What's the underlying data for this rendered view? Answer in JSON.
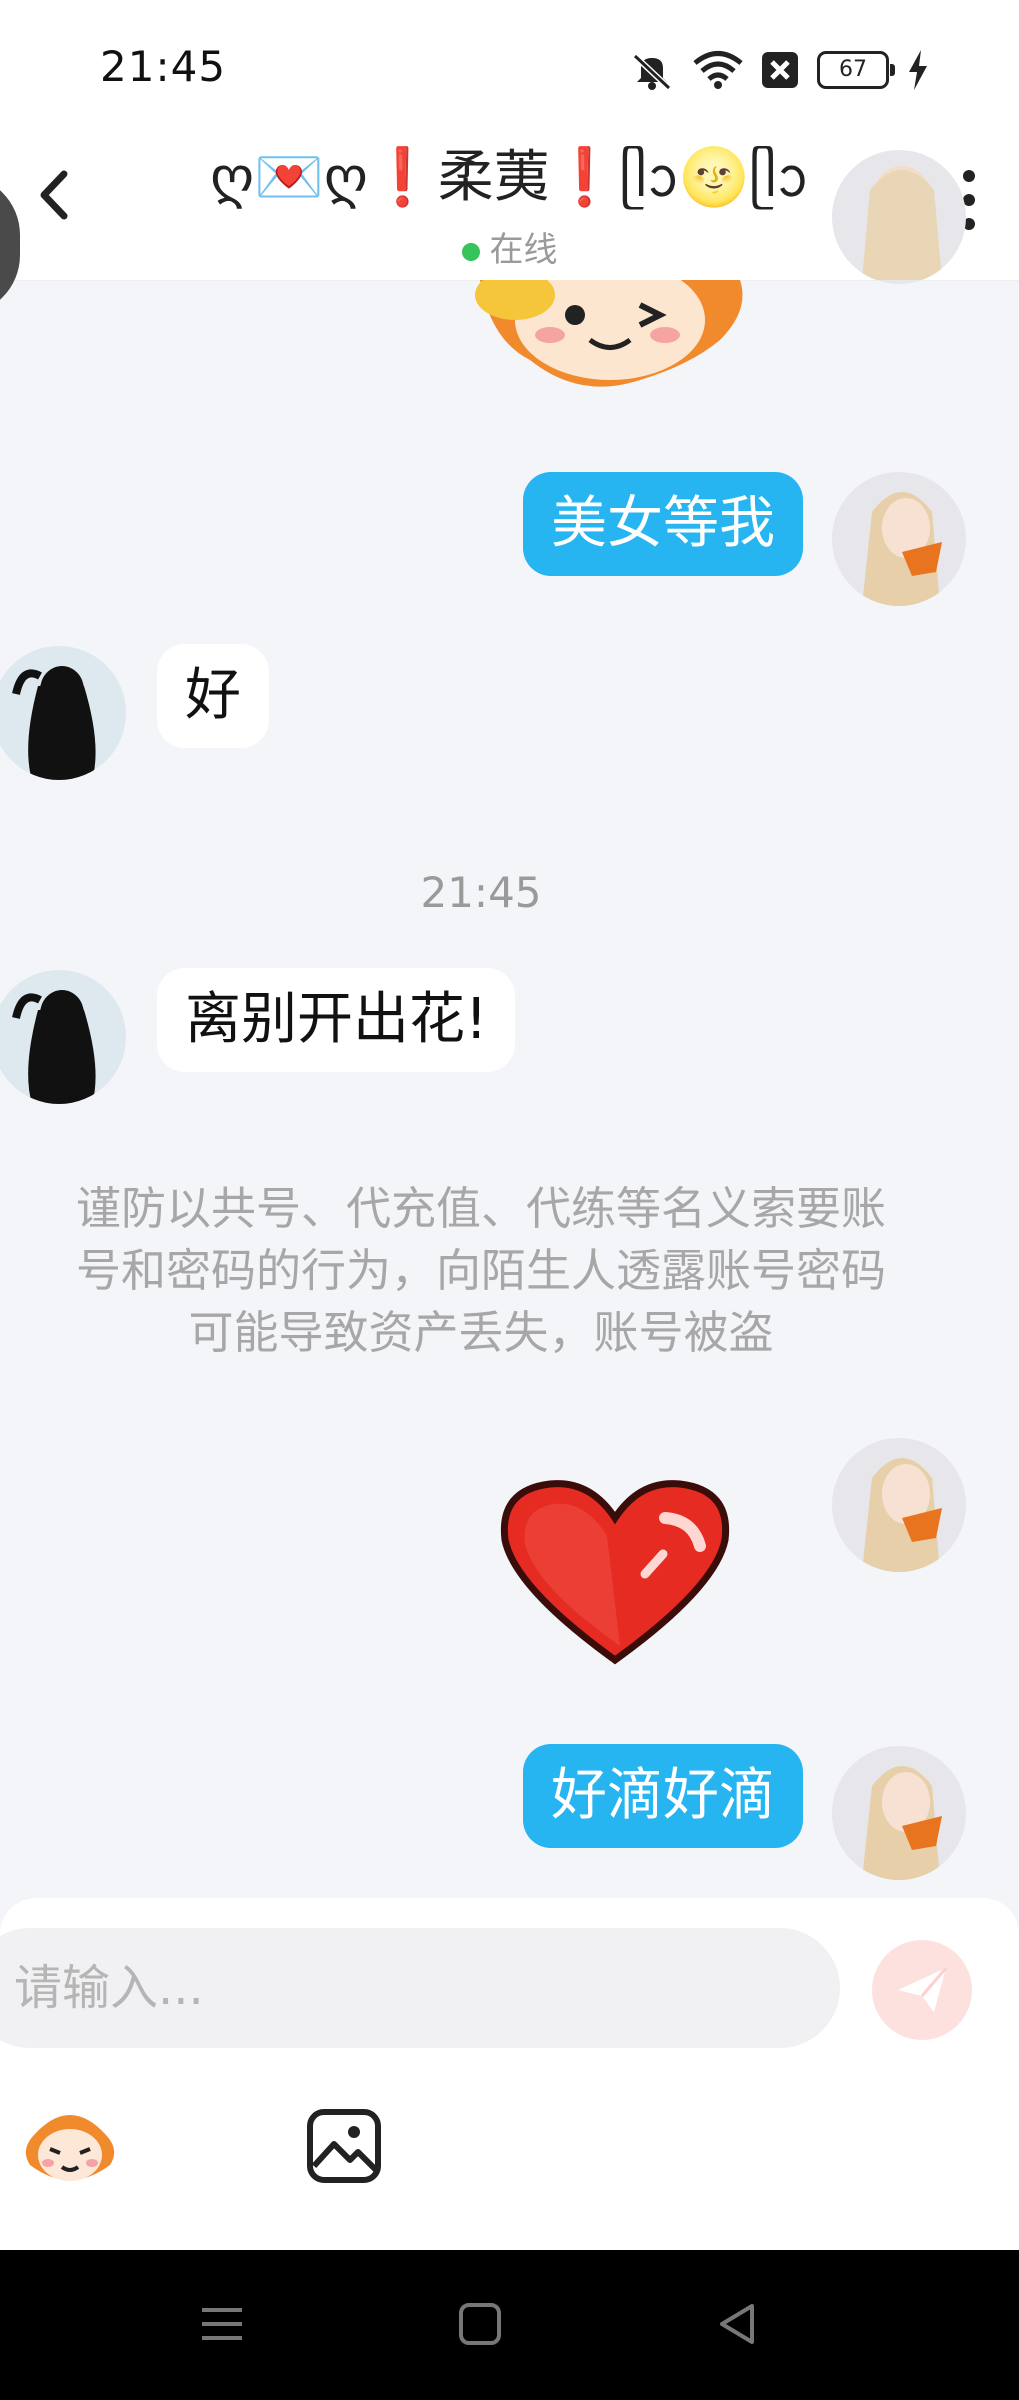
{
  "status_bar": {
    "time": "21:45",
    "battery": "67",
    "icons": [
      "mute-icon",
      "wifi-icon",
      "notification-x-icon",
      "battery-icon",
      "charging-bolt-icon"
    ]
  },
  "header": {
    "title": "ღ💌ღ❗柔荑❗ᥫᩣ🌝ᥫᩣ",
    "status": "在线",
    "back_icon": "chevron-left-icon",
    "more_icon": "more-vertical-icon"
  },
  "messages": [
    {
      "type": "sticker",
      "sender": "other",
      "sticker": "cartoon-face-sticker"
    },
    {
      "type": "text",
      "sender": "me",
      "text": "美女等我"
    },
    {
      "type": "text",
      "sender": "other",
      "text": "好"
    },
    {
      "type": "timestamp",
      "text": "21:45"
    },
    {
      "type": "text",
      "sender": "other",
      "text": "离别开出花!"
    },
    {
      "type": "notice",
      "lines": [
        "谨防以共号、代充值、代练等名义索要账",
        "号和密码的行为，向陌生人透露账号密码",
        "可能导致资产丢失，账号被盗"
      ]
    },
    {
      "type": "sticker",
      "sender": "me",
      "sticker": "red-heart-sticker"
    },
    {
      "type": "text",
      "sender": "me",
      "text": "好滴好滴"
    }
  ],
  "input": {
    "placeholder": "请输入...",
    "value": ""
  },
  "toolbar": {
    "send_icon": "send-icon",
    "emoji_icon": "emoji-face-icon",
    "image_icon": "image-icon"
  },
  "colors": {
    "background": "#f4f5f9",
    "my_bubble": "#26b5f0",
    "other_bubble": "#ffffff",
    "online": "#35c35a",
    "send_button": "#fde1df"
  }
}
